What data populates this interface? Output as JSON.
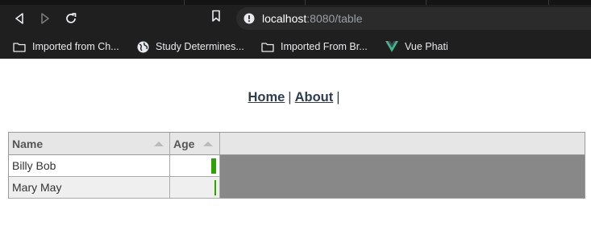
{
  "browser": {
    "url_host": "localhost",
    "url_rest": ":8080/table",
    "bookmarks": [
      {
        "label": "Imported from Ch...",
        "icon": "folder-icon"
      },
      {
        "label": "Study Determines...",
        "icon": "globe-icon"
      },
      {
        "label": "Imported From Br...",
        "icon": "folder-icon"
      },
      {
        "label": "Vue Phati",
        "icon": "vue-logo-icon"
      }
    ]
  },
  "nav": {
    "home": "Home",
    "about": "About",
    "separator": "|"
  },
  "table": {
    "columns": [
      {
        "label": "Name"
      },
      {
        "label": "Age"
      }
    ],
    "rows": [
      {
        "name": "Billy Bob",
        "age_bar_fraction": 1.0
      },
      {
        "name": "Mary May",
        "age_bar_fraction": 0.25
      }
    ]
  },
  "colors": {
    "bar": "#2ea300",
    "link": "#2c3e50"
  }
}
